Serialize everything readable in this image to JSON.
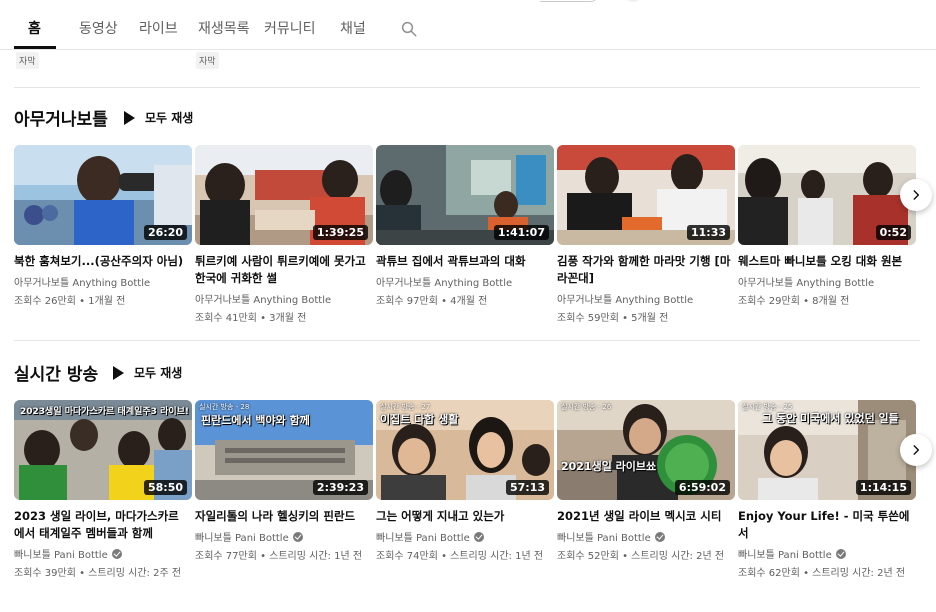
{
  "tabs": [
    {
      "label": "홈"
    },
    {
      "label": "동영상"
    },
    {
      "label": "라이브"
    },
    {
      "label": "재생목록"
    },
    {
      "label": "커뮤니티"
    },
    {
      "label": "채널"
    }
  ],
  "badges": [
    "자막",
    "자막"
  ],
  "sections": [
    {
      "title": "아무거나보틀",
      "play_all": "모두 재생",
      "videos": [
        {
          "duration": "26:20",
          "title": "북한 훔쳐보기...(공산주의자 아님)",
          "channel": "아무거나보틀 Anything Bottle",
          "meta": "조회수 26만회 • 1개월 전"
        },
        {
          "duration": "1:39:25",
          "title": "튀르키예 사람이 튀르키예에 못가고 한국에 귀화한 썰",
          "channel": "아무거나보틀 Anything Bottle",
          "meta": "조회수 41만회 • 3개월 전"
        },
        {
          "duration": "1:41:07",
          "title": "곽튜브 집에서 곽튜브과의 대화",
          "channel": "아무거나보틀 Anything Bottle",
          "meta": "조회수 97만회 • 4개월 전"
        },
        {
          "duration": "11:33",
          "title": "김풍 작가와 함께한 마라맛 기행 [마라꼰대]",
          "channel": "아무거나보틀 Anything Bottle",
          "meta": "조회수 59만회 • 5개월 전"
        },
        {
          "duration": "0:52",
          "title": "웨스트마 빠니보틀 오킹 대화 원본",
          "channel": "아무거나보틀 Anything Bottle",
          "meta": "조회수 29만회 • 8개월 전"
        }
      ]
    },
    {
      "title": "실시간 방송",
      "play_all": "모두 재생",
      "videos": [
        {
          "duration": "58:50",
          "title": "2023 생일 라이브, 마다가스카르에서 태계일주 멤버들과 함께",
          "channel": "빠니보틀 Pani Bottle",
          "meta": "조회수 39만회 • 스트리밍 시간: 2주 전",
          "overlay": "2023생일 마다가스카르 태계일주3 라이브!",
          "tag": ""
        },
        {
          "duration": "2:39:23",
          "title": "자일리톨의 나라 헬싱키의 핀란드",
          "channel": "빠니보틀 Pani Bottle",
          "meta": "조회수 77만회 • 스트리밍 시간: 1년 전",
          "overlay": "핀란드에서 백야와 함께",
          "tag": "실시간 방송 - 28"
        },
        {
          "duration": "57:13",
          "title": "그는 어떻게 지내고 있는가",
          "channel": "빠니보틀 Pani Bottle",
          "meta": "조회수 74만회 • 스트리밍 시간: 1년 전",
          "overlay": "이집트 다합 생활",
          "tag": "실시간 방송 - 27"
        },
        {
          "duration": "6:59:02",
          "title": "2021년 생일 라이브 멕시코 시티",
          "channel": "빠니보틀 Pani Bottle",
          "meta": "조회수 52만회 • 스트리밍 시간: 2년 전",
          "overlay": "2021생일 라이브쑈",
          "tag": "실시간 방송 - 26"
        },
        {
          "duration": "1:14:15",
          "title": "Enjoy Your Life! - 미국 투쓴에서",
          "channel": "빠니보틀 Pani Bottle",
          "meta": "조회수 62만회 • 스트리밍 시간: 2년 전",
          "overlay": "그 동안 미국에서 있었던 일들",
          "tag": "실시간 방송 - 25"
        }
      ]
    }
  ],
  "icons": {
    "search": "search-icon",
    "next": "chevron-right-icon",
    "play": "play-icon",
    "verified": "verified-icon"
  }
}
